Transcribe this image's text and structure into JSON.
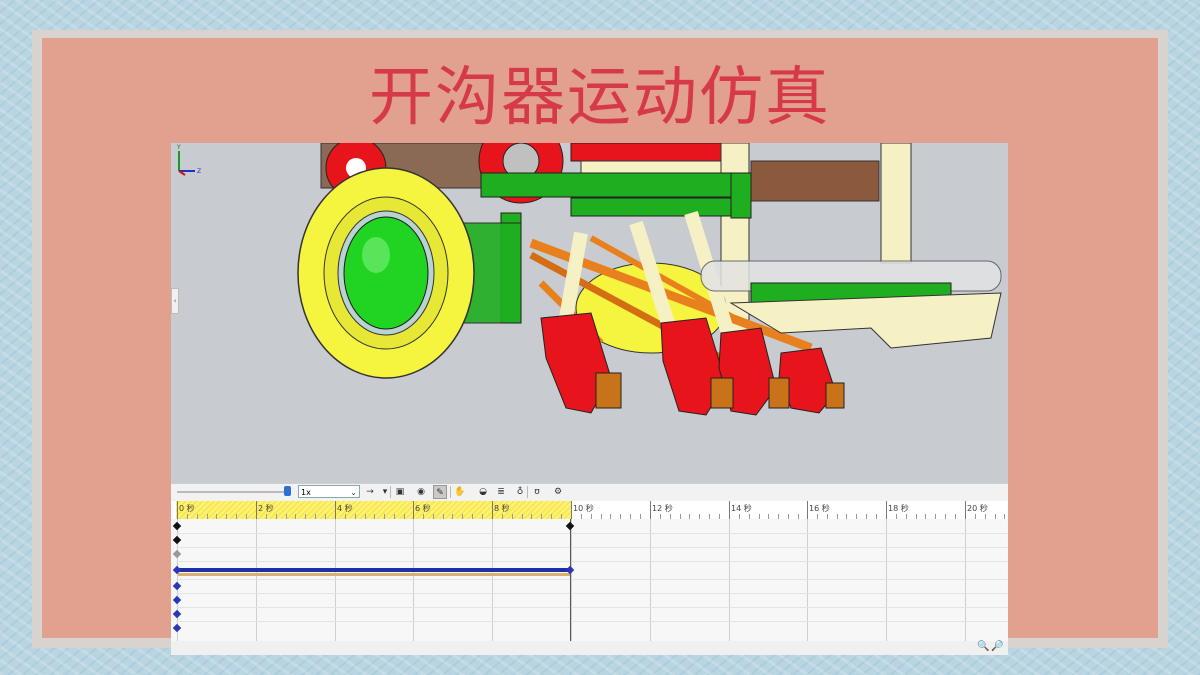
{
  "slide": {
    "title": "开沟器运动仿真"
  },
  "toolbar": {
    "speed_value": "1x",
    "buttons": [
      {
        "name": "play-arrow-icon",
        "glyph": "→"
      },
      {
        "name": "dropdown-arrow-icon",
        "glyph": "▾"
      },
      {
        "name": "save-animation-icon",
        "glyph": "▣"
      },
      {
        "name": "animation-wizard-icon",
        "glyph": "◉"
      },
      {
        "name": "autokey-icon",
        "glyph": "✎"
      },
      {
        "name": "add-update-key-icon",
        "glyph": "✋"
      },
      {
        "name": "motor-icon",
        "glyph": "◒"
      },
      {
        "name": "spring-icon",
        "glyph": "≣"
      },
      {
        "name": "damper-icon",
        "glyph": "♁"
      },
      {
        "name": "contact-icon",
        "glyph": "ʊ"
      },
      {
        "name": "motion-study-properties-icon",
        "glyph": "⚙"
      }
    ]
  },
  "timeline": {
    "unit": "秒",
    "ticks": [
      "0 秒",
      "2 秒",
      "4 秒",
      "6 秒",
      "8 秒",
      "10 秒",
      "12 秒",
      "14 秒",
      "16 秒",
      "18 秒",
      "20 秒"
    ]
  },
  "viewport": {
    "axis_labels": {
      "y": "Y",
      "z": "Z"
    }
  },
  "colors": {
    "title": "#d63a48",
    "slide_bg": "#e2a08e",
    "frame": "#b8d5e1",
    "wheel_yellow": "#f5f540",
    "frame_green": "#1fae1f",
    "opener_red": "#e8141b",
    "rod_orange": "#e8801e",
    "cream": "#f6f1c4"
  }
}
